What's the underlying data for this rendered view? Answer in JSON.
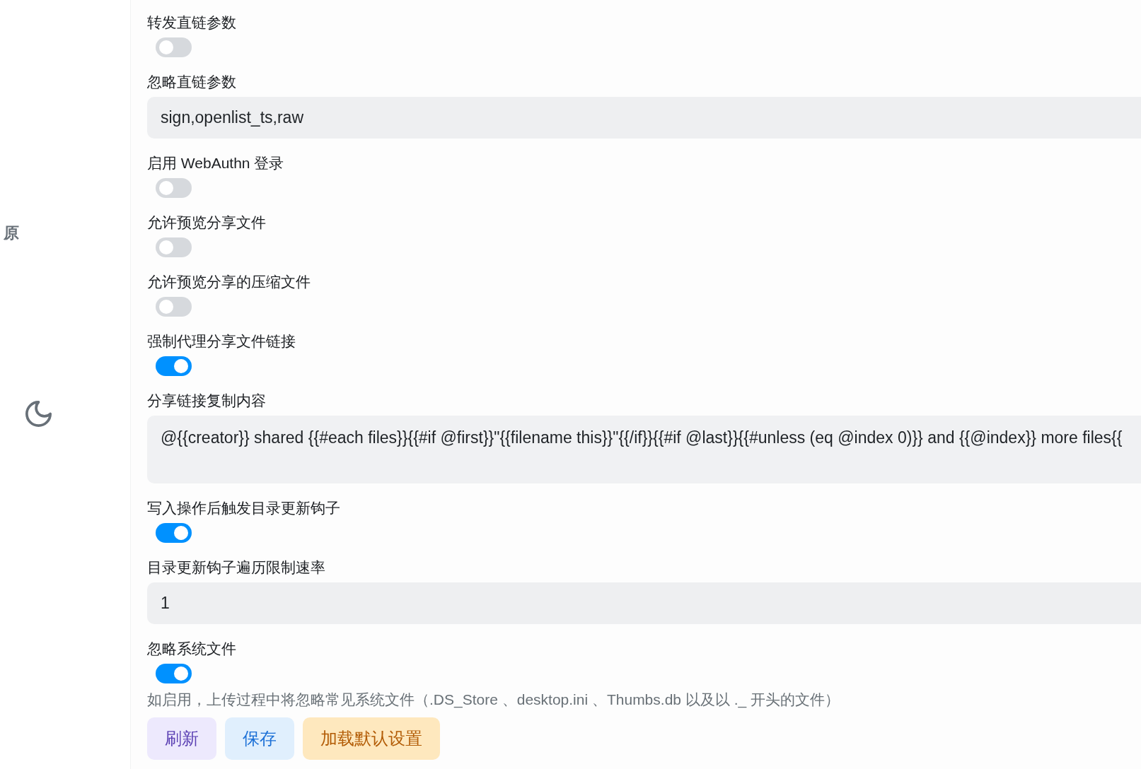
{
  "sidebar": {
    "items": [
      {
        "label": "原"
      }
    ]
  },
  "settings": [
    {
      "kind": "switch",
      "label": "转发直链参数",
      "on": false
    },
    {
      "kind": "text",
      "label": "忽略直链参数",
      "value": "sign,openlist_ts,raw"
    },
    {
      "kind": "switch",
      "label": "启用 WebAuthn 登录",
      "on": false
    },
    {
      "kind": "switch",
      "label": "允许预览分享文件",
      "on": false
    },
    {
      "kind": "switch",
      "label": "允许预览分享的压缩文件",
      "on": false
    },
    {
      "kind": "switch",
      "label": "强制代理分享文件链接",
      "on": true
    },
    {
      "kind": "textarea",
      "label": "分享链接复制内容",
      "value": "@{{creator}} shared {{#each files}}{{#if @first}}\"{{filename this}}\"{{/if}}{{#if @last}}{{#unless (eq @index 0)}} and {{@index}} more files{{"
    },
    {
      "kind": "switch",
      "label": "写入操作后触发目录更新钩子",
      "on": true
    },
    {
      "kind": "text",
      "label": "目录更新钩子遍历限制速率",
      "value": "1"
    },
    {
      "kind": "switch",
      "label": "忽略系统文件",
      "on": true,
      "help": "如启用，上传过程中将忽略常见系统文件（.DS_Store 、desktop.ini 、Thumbs.db 以及以 ._ 开头的文件）"
    }
  ],
  "buttons": [
    {
      "label": "刷新",
      "kind": "neutral"
    },
    {
      "label": "保存",
      "kind": "primary"
    },
    {
      "label": "加载默认设置",
      "kind": "warning"
    }
  ]
}
